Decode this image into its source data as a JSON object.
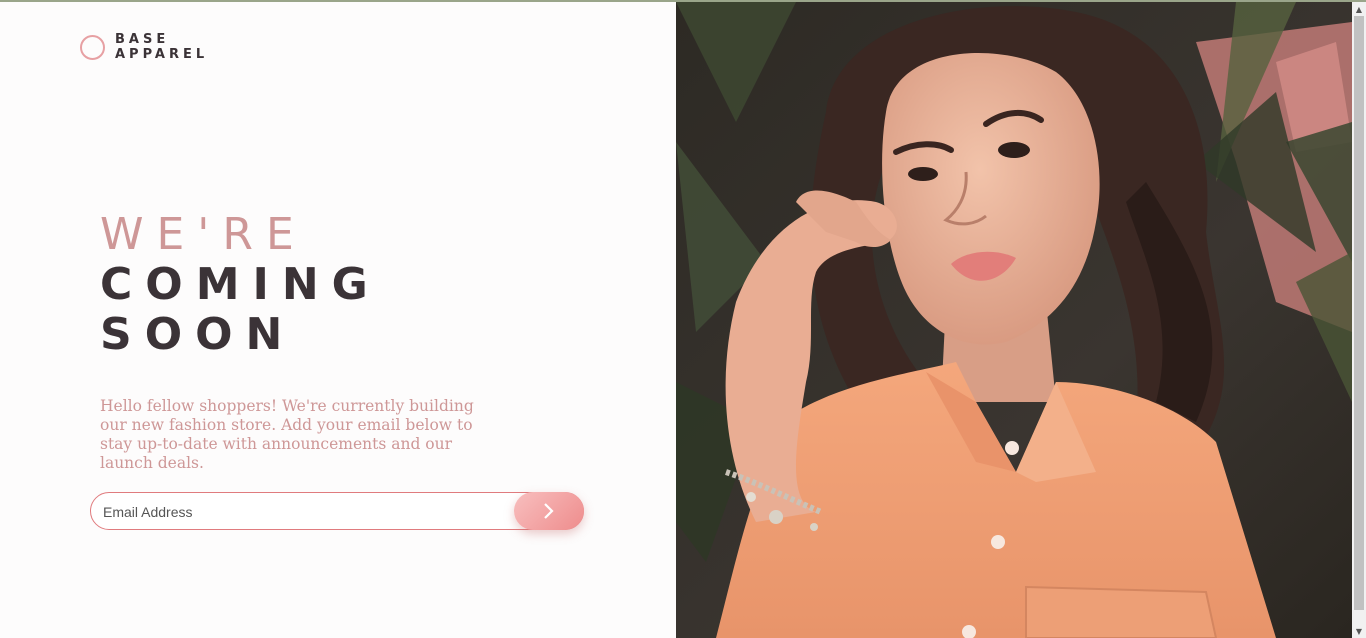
{
  "brand": {
    "line1": "BASE",
    "line2": "APPAREL"
  },
  "hero": {
    "line1": "WE'RE",
    "line2": "COMING",
    "line3": "SOON"
  },
  "intro_text": "Hello fellow shoppers! We're currently building our new fashion store. Add your email below to stay up-to-date with announcements and our launch deals.",
  "form": {
    "email_placeholder": "Email Address",
    "email_value": "",
    "submit_icon": "chevron-right-icon"
  },
  "hero_image": {
    "subject": "woman-in-peach-shirt-photo"
  },
  "colors": {
    "accent": "#ce9797",
    "dark": "#3b3337",
    "error": "#e07b7e",
    "button_from": "#f8bfbf",
    "button_to": "#ee8c8c"
  }
}
